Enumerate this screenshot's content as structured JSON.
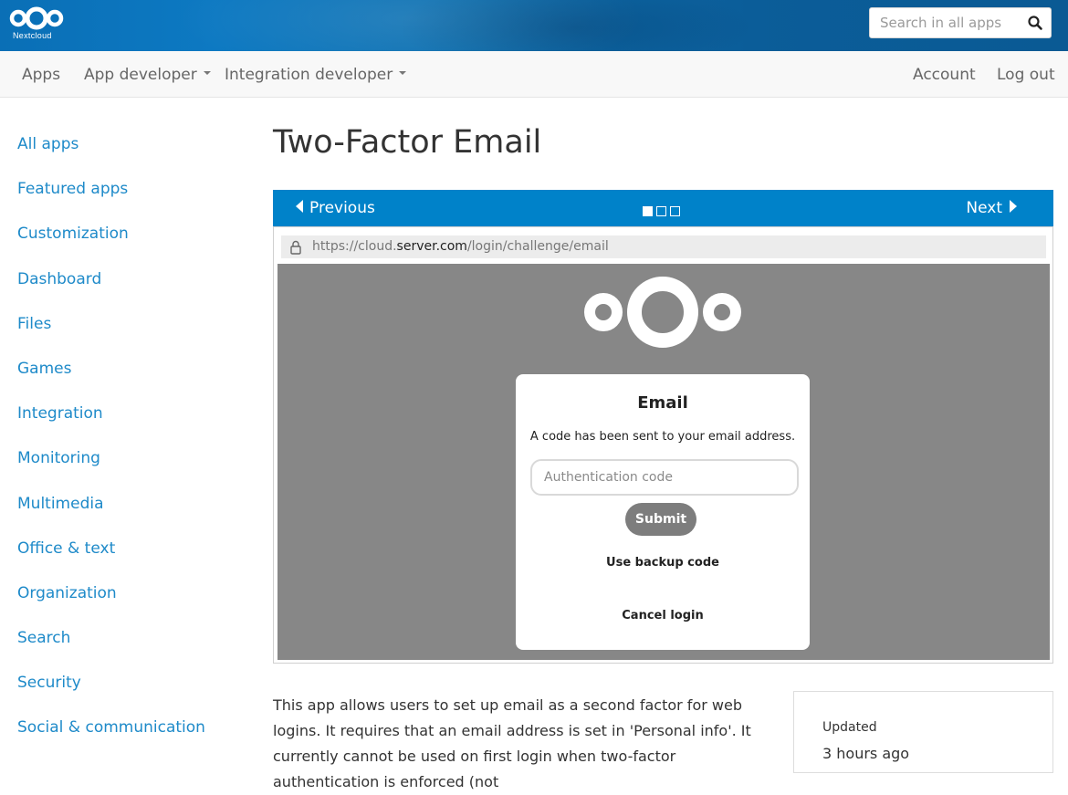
{
  "header": {
    "logo_text": "Nextcloud",
    "search_placeholder": "Search in all apps"
  },
  "nav": {
    "apps": "Apps",
    "app_developer": "App developer",
    "integration_developer": "Integration developer",
    "account": "Account",
    "logout": "Log out"
  },
  "sidebar": {
    "items": [
      {
        "label": "All apps"
      },
      {
        "label": "Featured apps"
      },
      {
        "label": "Customization"
      },
      {
        "label": "Dashboard"
      },
      {
        "label": "Files"
      },
      {
        "label": "Games"
      },
      {
        "label": "Integration"
      },
      {
        "label": "Monitoring"
      },
      {
        "label": "Multimedia"
      },
      {
        "label": "Office & text"
      },
      {
        "label": "Organization"
      },
      {
        "label": "Search"
      },
      {
        "label": "Security"
      },
      {
        "label": "Social & communication"
      }
    ]
  },
  "page": {
    "title": "Two-Factor Email"
  },
  "carousel": {
    "previous": "Previous",
    "next": "Next",
    "slide_count": 3,
    "active_slide": 1
  },
  "screenshot": {
    "url_prefix": "https://cloud.",
    "url_host": "server.com",
    "url_path": "/login/challenge/email",
    "card_title": "Email",
    "card_description": "A code has been sent to your email address.",
    "code_placeholder": "Authentication code",
    "submit": "Submit",
    "backup": "Use backup code",
    "cancel": "Cancel login"
  },
  "description": "This app allows users to set up email as a second factor for web logins. It requires that an email address is set in 'Personal info'. It currently cannot be used on first login when two-factor authentication is enforced (not",
  "info": {
    "updated_label": "Updated",
    "updated_value": "3 hours ago"
  },
  "colors": {
    "brand": "#0082c9",
    "link": "#1e8ac9",
    "screenshot_bg": "#878787"
  }
}
